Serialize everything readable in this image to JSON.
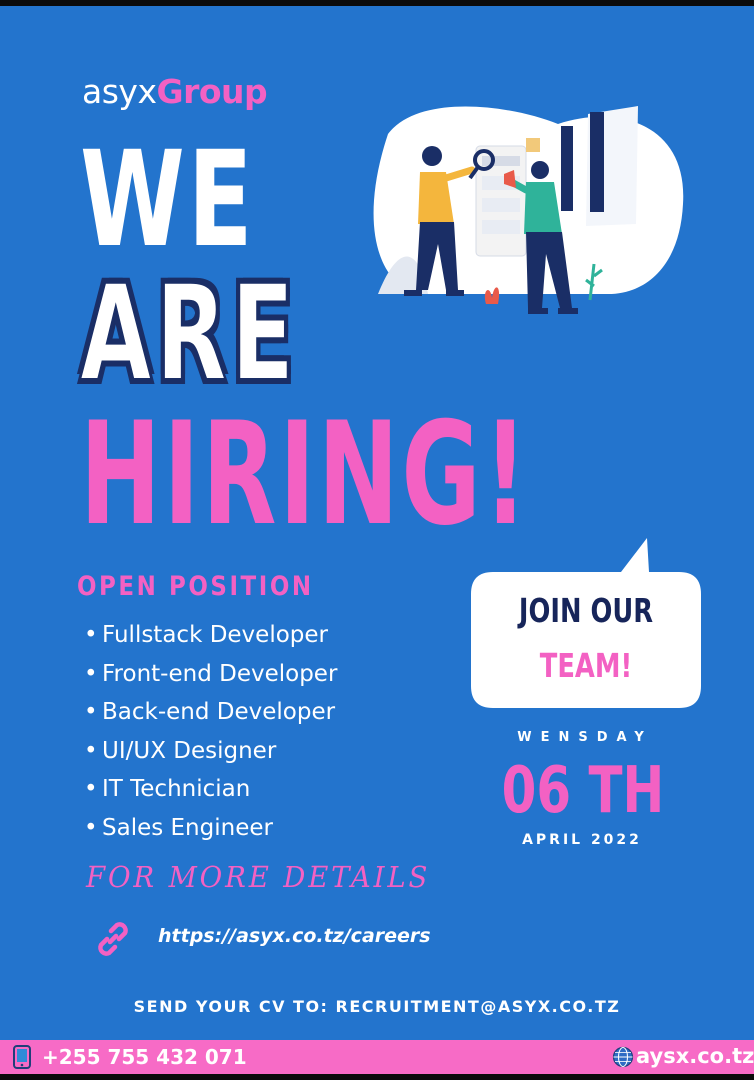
{
  "brand": {
    "part1": "asyx",
    "part2": "Group"
  },
  "headline": {
    "line1": "WE",
    "line2": "ARE",
    "line3": "HIRING!"
  },
  "open_positions": {
    "title": "OPEN POSITION",
    "items": [
      "Fullstack Developer",
      "Front-end Developer",
      "Back-end Developer",
      "UI/UX Designer",
      "IT Technician",
      "Sales Engineer"
    ]
  },
  "callout": {
    "line1": "JOIN OUR",
    "line2": "TEAM!"
  },
  "date": {
    "day": "WENSDAY",
    "number": "06 TH",
    "month_year": "APRIL 2022"
  },
  "details": {
    "label": "FOR MORE DETAILS",
    "url": "https://asyx.co.tz/careers"
  },
  "send_cv": "SEND YOUR CV TO: RECRUITMENT@ASYX.CO.TZ",
  "footer": {
    "phone": "+255 755 432 071",
    "website": "aysx.co.tz"
  },
  "colors": {
    "background": "#2374cd",
    "accent_pink": "#f361c3",
    "navy": "#17255a",
    "footer_bar": "#f76bc6"
  },
  "icons": {
    "link": "link-chain-icon",
    "phone": "phone-icon",
    "web": "globe-icon"
  }
}
